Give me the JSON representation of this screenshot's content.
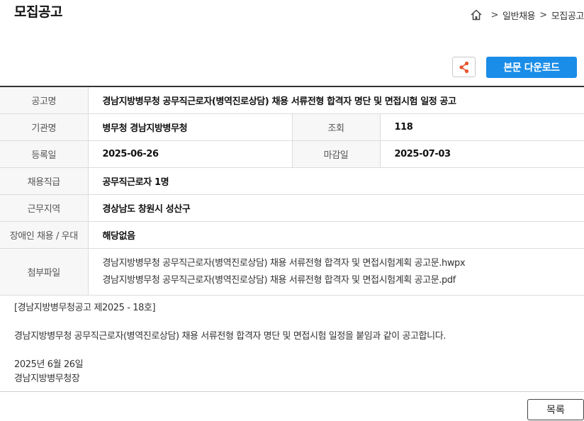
{
  "page": {
    "title": "모집공고"
  },
  "breadcrumb": {
    "home_icon": "home-icon",
    "items": [
      "일반채용",
      "모집공고"
    ],
    "separator": ">"
  },
  "actions": {
    "share_icon": "share-icon",
    "share_color": "#e8542b",
    "download_label": "본문 다운로드",
    "download_color": "#1a8de8"
  },
  "info": {
    "title": {
      "label": "공고명",
      "value": "경남지방병무청 공무직근로자(병역진로상담) 채용 서류전형 합격자 명단 및 면접시험 일정 공고"
    },
    "org": {
      "label": "기관명",
      "value": "병무청 경남지방병무청"
    },
    "views": {
      "label": "조회",
      "value": "118"
    },
    "reg_date": {
      "label": "등록일",
      "value": "2025-06-26"
    },
    "deadline": {
      "label": "마감일",
      "value": "2025-07-03"
    },
    "job_level": {
      "label": "채용직급",
      "value": "공무직근로자 1명"
    },
    "location": {
      "label": "근무지역",
      "value": "경상남도 창원시 성산구"
    },
    "disabled": {
      "label": "장애인 채용 / 우대",
      "value": "해당없음"
    },
    "attachments": {
      "label": "첨부파일",
      "files": [
        "경남지방병무청 공무직근로자(병역진로상담) 채용 서류전형 합격자 및 면접시험계획 공고문.hwpx",
        "경남지방병무청 공무직근로자(병역진로상담) 채용 서류전형 합격자 및 면접시험계획 공고문.pdf"
      ]
    }
  },
  "body": {
    "notice_no": "[경남지방병무청공고 제2025 - 18호]",
    "paragraph": "경남지방병무청 공무직근로자(병역진로상담) 채용 서류전형 합격자 명단 및 면접시험 일정을 붙임과 같이 공고합니다.",
    "date": "2025년 6월 26일",
    "signer": "경남지방병무청장"
  },
  "footer": {
    "list_label": "목록"
  }
}
